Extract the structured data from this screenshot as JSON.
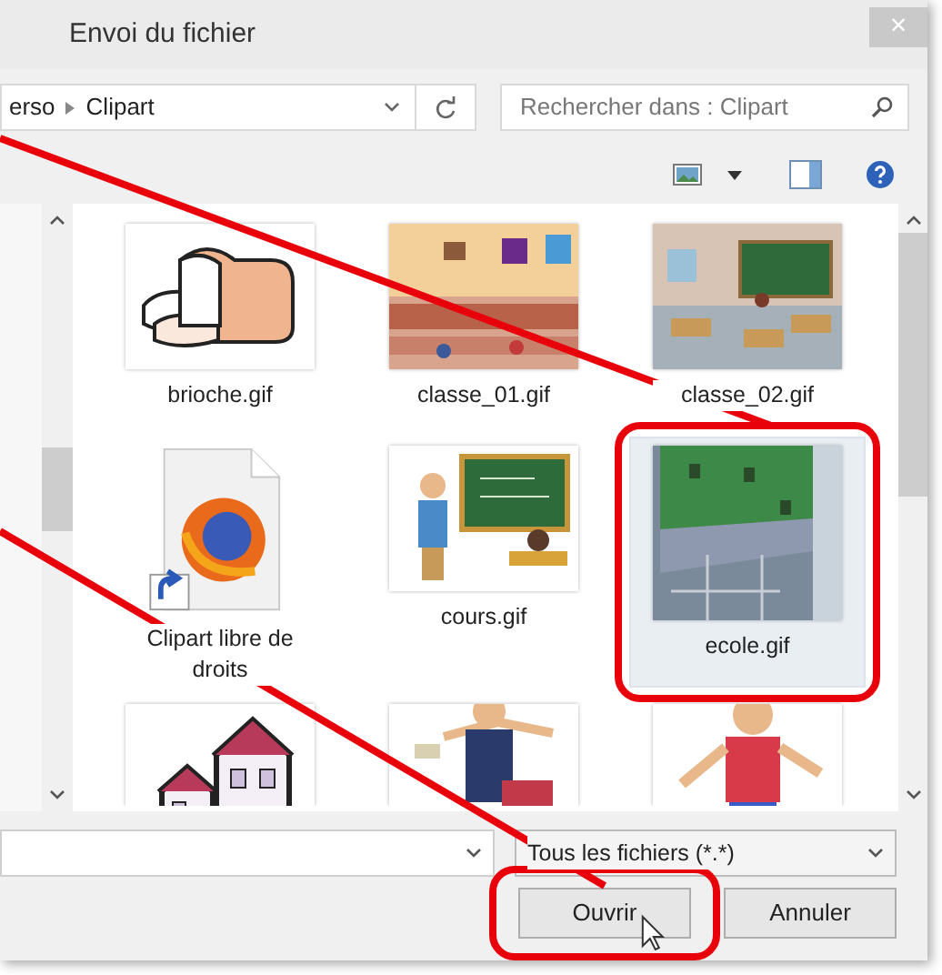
{
  "window": {
    "title": "Envoi du fichier",
    "close": "×"
  },
  "address_bar": {
    "path": [
      "erso",
      "Clipart"
    ]
  },
  "search": {
    "placeholder": "Rechercher dans : Clipart"
  },
  "files": [
    {
      "name": "brioche.gif",
      "kind": "picture",
      "selected": false,
      "highlighted": false
    },
    {
      "name": "classe_01.gif",
      "kind": "picture",
      "selected": false,
      "highlighted": false
    },
    {
      "name": "classe_02.gif",
      "kind": "picture",
      "selected": false,
      "highlighted": false
    },
    {
      "name": "Clipart libre de droits",
      "kind": "shortcut",
      "selected": false,
      "highlighted": false
    },
    {
      "name": "cours.gif",
      "kind": "picture",
      "selected": false,
      "highlighted": false
    },
    {
      "name": "ecole.gif",
      "kind": "picture",
      "selected": true,
      "highlighted": true
    },
    {
      "kind": "picture",
      "selected": false,
      "highlighted": false
    },
    {
      "kind": "picture",
      "selected": false,
      "highlighted": false
    },
    {
      "kind": "picture",
      "selected": false,
      "highlighted": false
    }
  ],
  "file_type": {
    "value": "Tous les fichiers (*.*)"
  },
  "buttons": [
    {
      "label": "Ouvrir",
      "highlighted": true
    },
    {
      "label": "Annuler",
      "highlighted": false
    }
  ]
}
